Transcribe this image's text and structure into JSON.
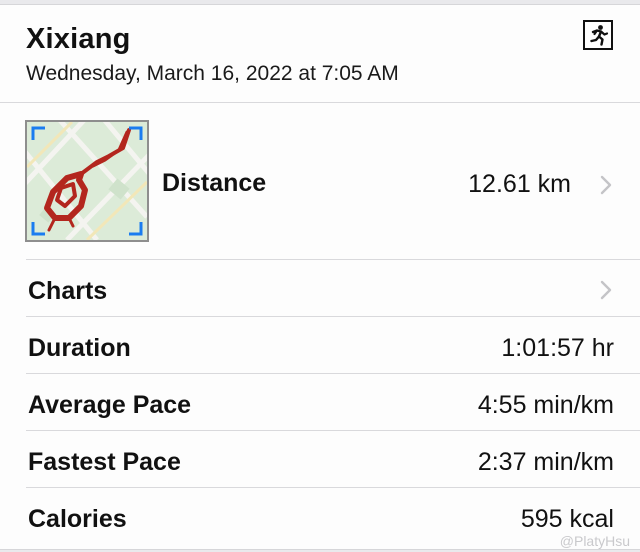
{
  "workout": {
    "title": "Xixiang",
    "subtitle": "Wednesday, March 16, 2022 at 7:05 AM",
    "type_icon": "running-figure-icon"
  },
  "distance": {
    "label": "Distance",
    "value": "12.61 km",
    "map_icon": "route-map-thumbnail"
  },
  "charts": {
    "label": "Charts"
  },
  "stats": [
    {
      "label": "Duration",
      "value": "1:01:57 hr"
    },
    {
      "label": "Average Pace",
      "value": "4:55 min/km"
    },
    {
      "label": "Fastest Pace",
      "value": "2:37 min/km"
    },
    {
      "label": "Calories",
      "value": "595 kcal"
    }
  ],
  "watermark": "@PlatyHsu",
  "colors": {
    "route": "#b3261e",
    "map_corner_brackets": "#1a7cf0",
    "map_background": "#dcebd8",
    "chevron": "#c4c4c7",
    "divider": "#d9d9dc"
  }
}
